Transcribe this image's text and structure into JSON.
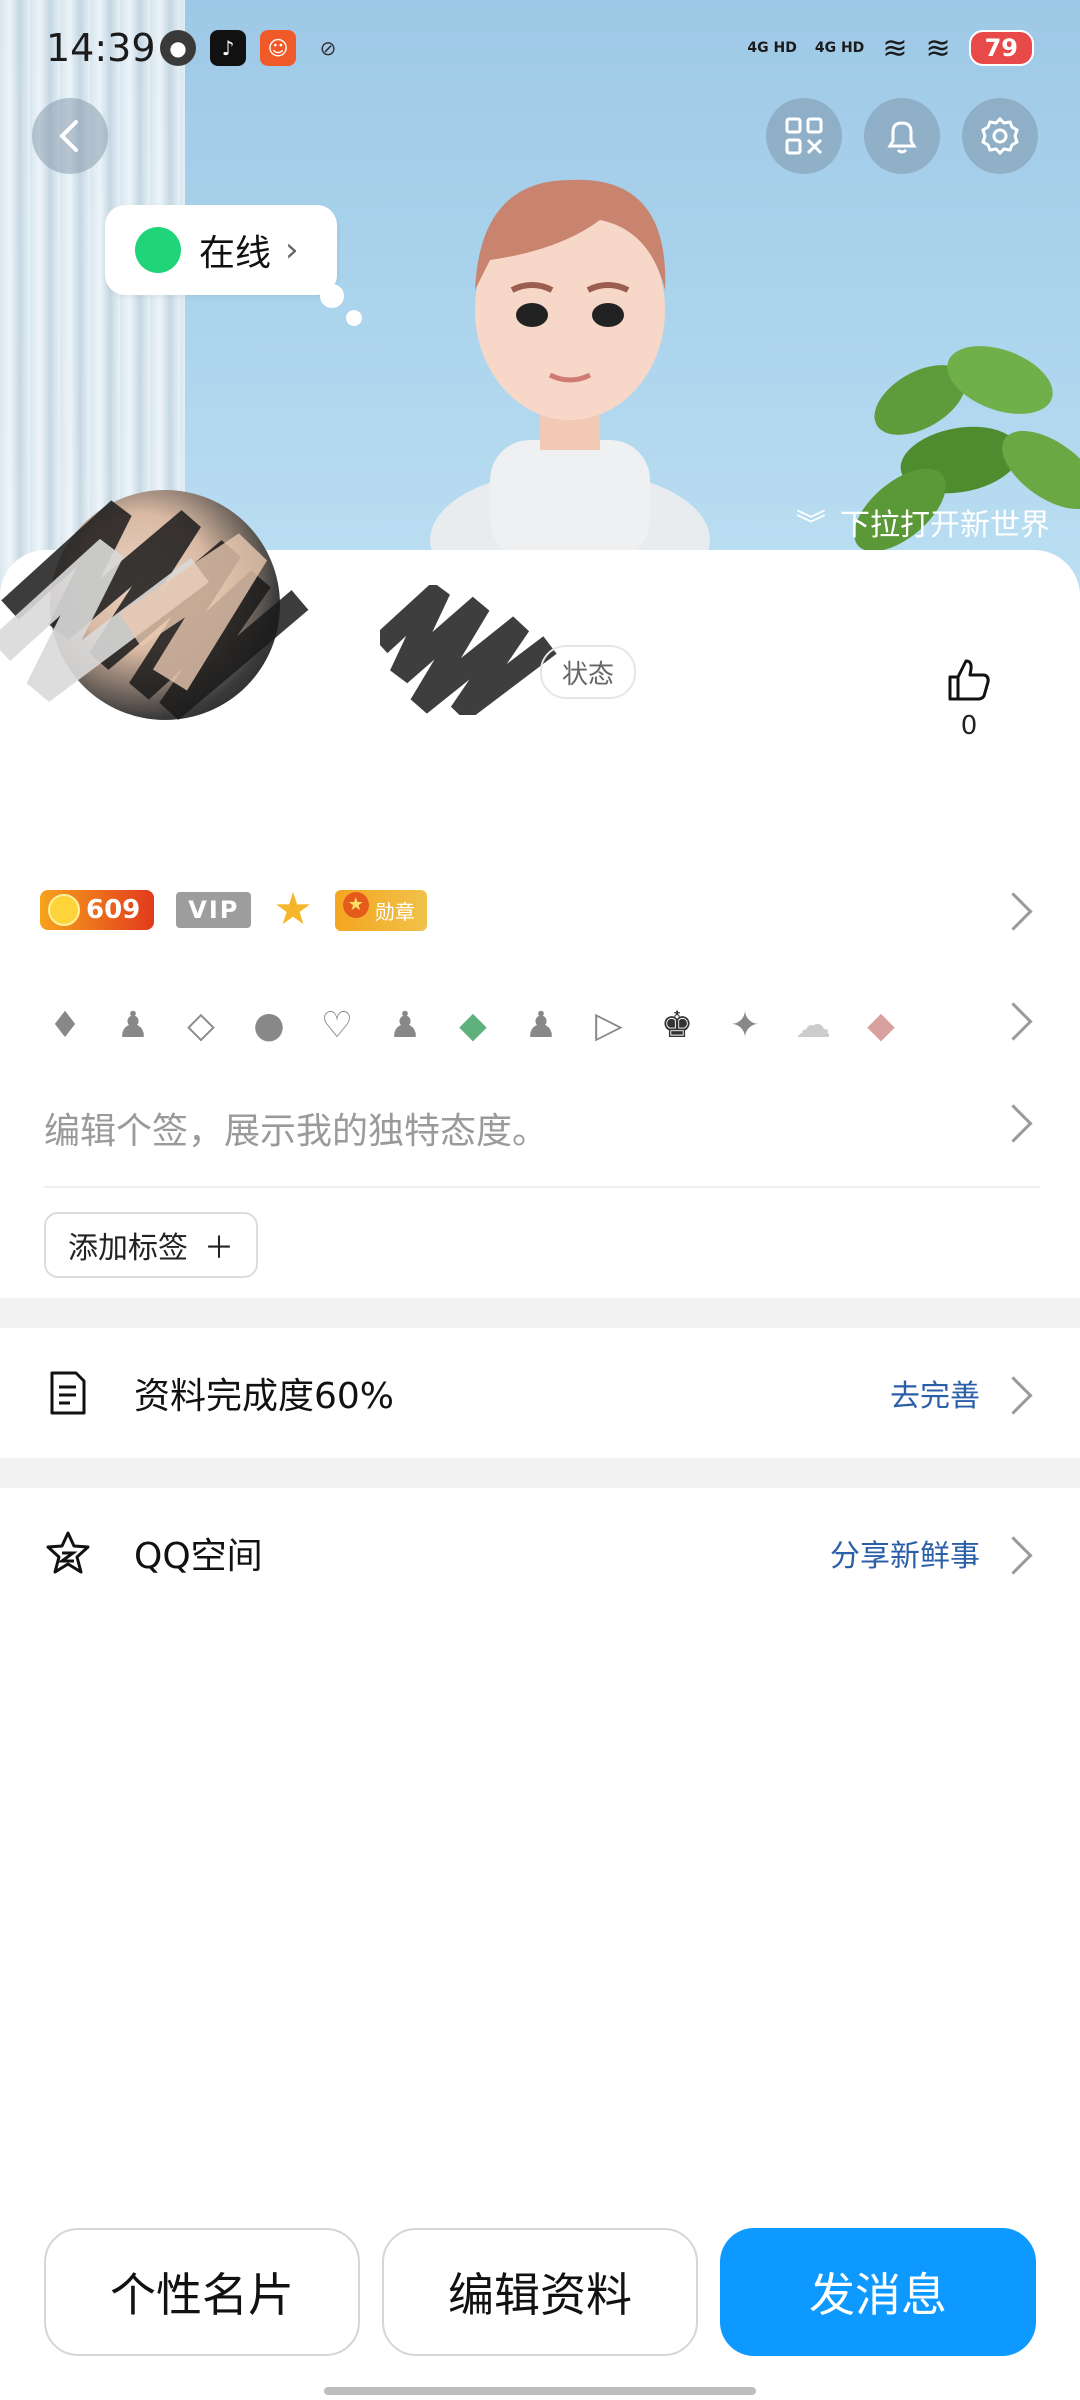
{
  "status_bar": {
    "time": "14:39",
    "signal1": "4G HD",
    "signal2": "4G HD",
    "battery": "79"
  },
  "header": {
    "online_status": "在线",
    "pull_hint": "下拉打开新世界"
  },
  "profile": {
    "status_chip": "状态",
    "likes": "0",
    "level": "609",
    "vip_label": "VIP",
    "medal_label": "勋章",
    "signature_placeholder": "编辑个签，展示我的独特态度。",
    "add_tag_label": "添加标签",
    "add_tag_plus": "＋"
  },
  "rows": {
    "completion_label": "资料完成度60%",
    "completion_action": "去完善",
    "qzone_label": "QQ空间",
    "qzone_action": "分享新鲜事"
  },
  "buttons": {
    "card": "个性名片",
    "edit": "编辑资料",
    "message": "发消息"
  },
  "colors": {
    "accent": "#0d99ff",
    "link": "#2b5fa8",
    "online": "#20d47a"
  },
  "icons": [
    "back-icon",
    "qr-code-icon",
    "bell-icon",
    "settings-icon",
    "thumbs-up-icon",
    "document-icon",
    "qzone-star-icon"
  ]
}
